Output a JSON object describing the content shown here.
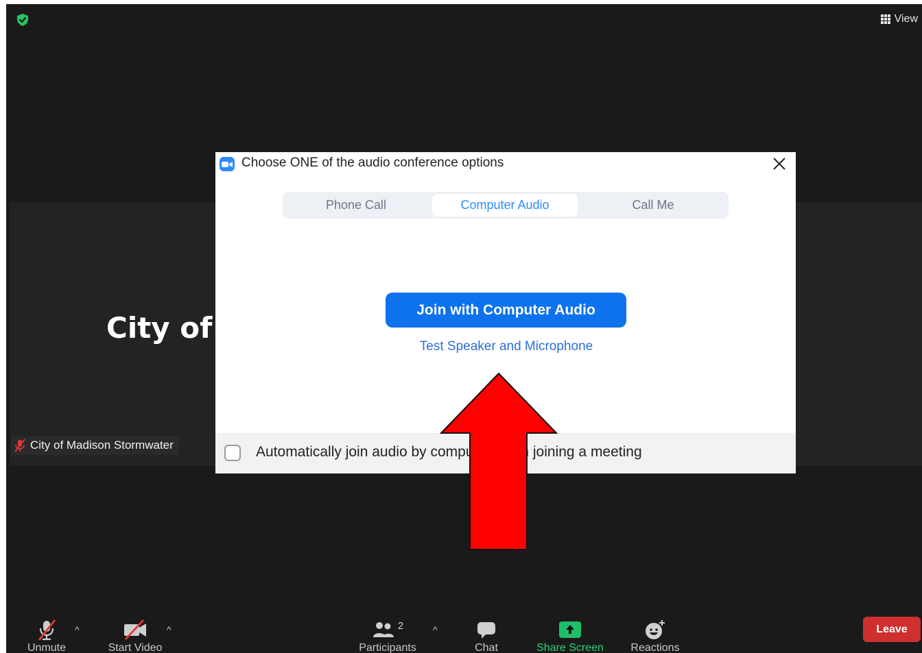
{
  "window": {
    "view_label": "View",
    "encryption_icon": "shield-check-icon",
    "view_icon": "grid-icon"
  },
  "participant_tile": {
    "display_text": "City of",
    "name_tag": "City of Madison Stormwater",
    "muted_icon": "mic-muted-icon"
  },
  "dialog": {
    "title": "Choose ONE of the audio conference options",
    "tabs": [
      {
        "label": "Phone Call",
        "active": false
      },
      {
        "label": "Computer Audio",
        "active": true
      },
      {
        "label": "Call Me",
        "active": false
      }
    ],
    "join_button": "Join with Computer Audio",
    "test_link": "Test Speaker and Microphone",
    "auto_join_label": "Automatically join audio by computer when joining a meeting",
    "auto_join_checked": false
  },
  "annotation": {
    "type": "arrow-up",
    "color": "#ff0000"
  },
  "toolbar": {
    "unmute": "Unmute",
    "start_video": "Start Video",
    "participants": "Participants",
    "participants_count": "2",
    "chat": "Chat",
    "share_screen": "Share Screen",
    "reactions": "Reactions",
    "leave": "Leave"
  },
  "colors": {
    "accent": "#2d8cff",
    "join_button": "#0e72ed",
    "share_green": "#1fbd6a",
    "leave_red": "#cf2f2f",
    "background": "#1a1a1a"
  }
}
